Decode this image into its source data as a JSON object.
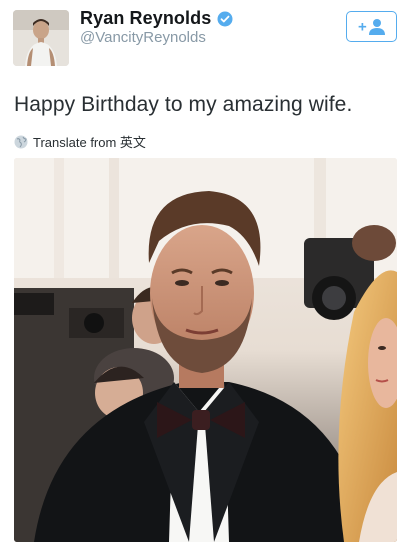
{
  "user": {
    "display_name": "Ryan Reynolds",
    "handle": "@VancityReynolds",
    "verified": true
  },
  "follow_button": {
    "label": "+",
    "icon": "follow-person-icon",
    "accent": "#55acee"
  },
  "tweet": {
    "text": "Happy Birthday to my amazing wife."
  },
  "translate": {
    "label": "Translate from 英文",
    "icon": "globe-icon"
  },
  "colors": {
    "accent": "#55acee",
    "secondary_text": "#8899a6",
    "verified_badge": "#55acee"
  }
}
